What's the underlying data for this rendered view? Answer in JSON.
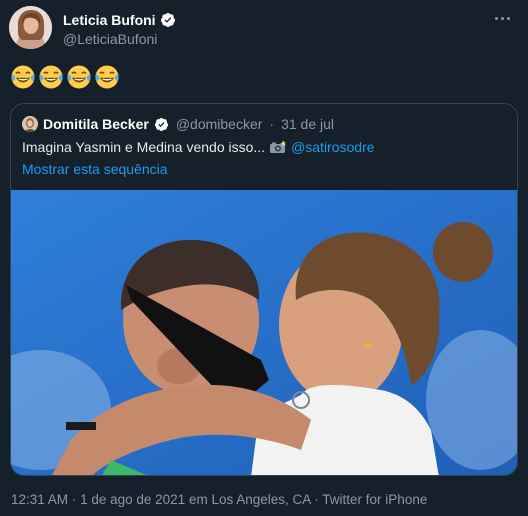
{
  "author": {
    "display_name": "Leticia Bufoni",
    "handle": "@LeticiaBufoni",
    "verified": true,
    "avatar_icon": "profile-photo"
  },
  "body": {
    "emojis": [
      "😂",
      "😂",
      "😂",
      "😂"
    ]
  },
  "quoted_tweet": {
    "display_name": "Domitila Becker",
    "handle": "@domibecker",
    "date": "31 de jul",
    "verified": true,
    "text": "Imagina Yasmin e Medina vendo isso...",
    "mention": "@satirosodre",
    "show_thread_link": "Mostrar esta sequência",
    "image_icon": "photo-couple-kissing"
  },
  "footer": {
    "time": "12:31 AM",
    "date": "1 de ago de 2021",
    "location": "em Los Angeles, CA",
    "source": "Twitter for iPhone"
  },
  "colors": {
    "background": "#15202b",
    "border": "#38444d",
    "link": "#1d9bf0",
    "muted": "#8b98a5",
    "verified": "#ffffff"
  }
}
